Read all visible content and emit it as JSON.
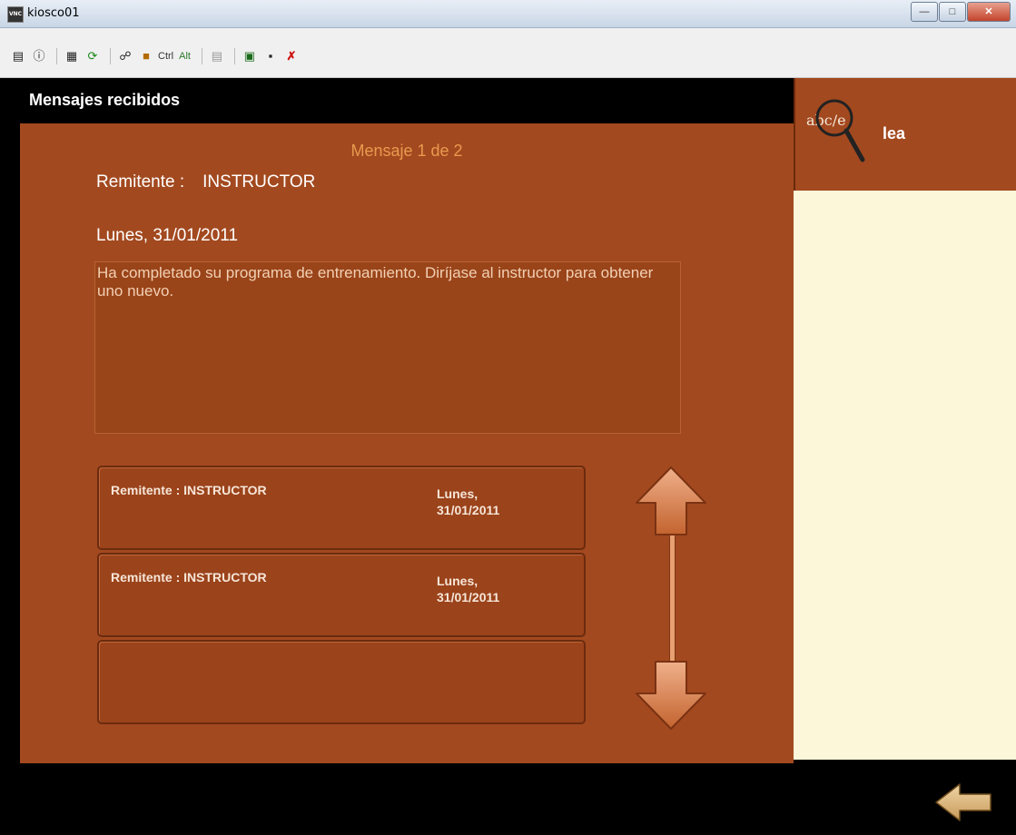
{
  "window": {
    "title": "kiosco01",
    "app_icon_text": "VNC",
    "buttons": [
      "minimize",
      "maximize",
      "close"
    ]
  },
  "toolbar": {
    "ctrl_label": "Ctrl",
    "alt_label": "Alt"
  },
  "screen": {
    "title": "Mensajes recibidos",
    "counter": "Mensaje 1 de 2",
    "sender_label": "Remitente :",
    "sender_value": "INSTRUCTOR",
    "date": "Lunes, 31/01/2011",
    "body": "Ha completado su programa de entrenamiento. Diríjase al instructor para obtener uno nuevo."
  },
  "messages": [
    {
      "sender": "Remitente : INSTRUCTOR",
      "date_line1": "Lunes,",
      "date_line2": "31/01/2011"
    },
    {
      "sender": "Remitente : INSTRUCTOR",
      "date_line1": "Lunes,",
      "date_line2": "31/01/2011"
    },
    {
      "sender": "",
      "date_line1": "",
      "date_line2": ""
    }
  ],
  "side": {
    "logo_text": "abc/e",
    "label": "lea"
  },
  "colors": {
    "panel": "#a3491f",
    "accent": "#e89a4f",
    "side_body": "#fdf7d9"
  }
}
